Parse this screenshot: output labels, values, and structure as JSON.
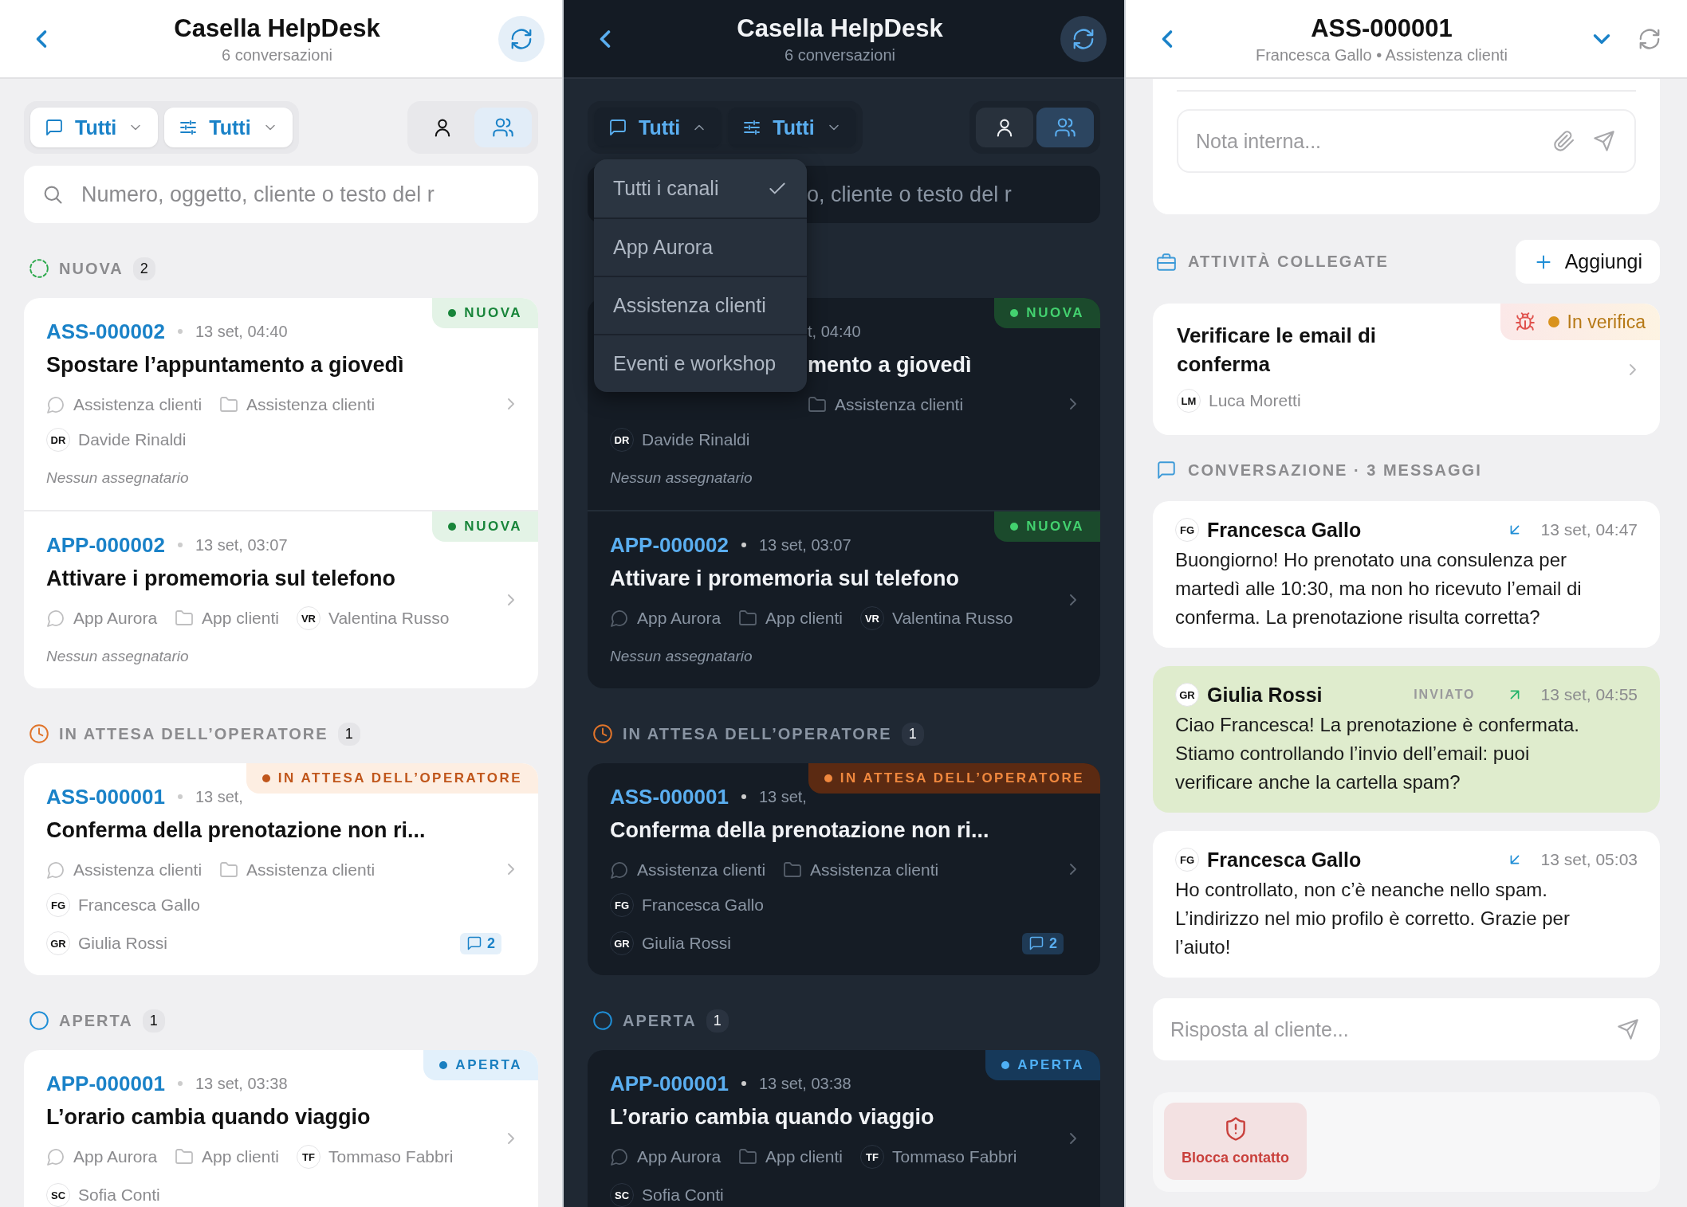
{
  "panels": [
    {
      "kind": "list",
      "dark": false,
      "header": {
        "title": "Casella HelpDesk",
        "subtitle": "6 conversazioni"
      },
      "filters": [
        {
          "kind": "channel",
          "label": "Tutti",
          "expanded": false
        },
        {
          "kind": "status",
          "label": "Tutti",
          "expanded": false
        }
      ],
      "views": [
        {
          "kind": "mine",
          "selected": false
        },
        {
          "kind": "team",
          "selected": true
        }
      ],
      "search": {
        "placeholder": "Numero, oggetto, cliente o testo del r"
      },
      "sections": [
        {
          "kind": "new",
          "label": "NUOVA",
          "count": "2",
          "tickets": [
            {
              "id": "ASS-000002",
              "time": "13 set, 04:40",
              "title": "Spostare l’appuntamento a giovedì",
              "channel": "Assistenza clienti",
              "folder": "Assistenza clienti",
              "customer": {
                "initials": "DR",
                "name": "Davide Rinaldi"
              },
              "unassigned": "Nessun assegnatario",
              "badge": {
                "kind": "new",
                "label": "NUOVA"
              }
            },
            {
              "id": "APP-000002",
              "time": "13 set, 03:07",
              "title": "Attivare i promemoria sul telefono",
              "channel": "App Aurora",
              "folder": "App clienti",
              "customer": {
                "initials": "VR",
                "name": "Valentina Russo"
              },
              "unassigned": "Nessun assegnatario",
              "badge": {
                "kind": "new",
                "label": "NUOVA"
              }
            }
          ]
        },
        {
          "kind": "waiting",
          "label": "IN ATTESA DELL’OPERATORE",
          "count": "1",
          "tickets": [
            {
              "id": "ASS-000001",
              "time": "13 set,",
              "title": "Conferma della prenotazione non ri...",
              "channel": "Assistenza clienti",
              "folder": "Assistenza clienti",
              "customer": {
                "initials": "FG",
                "name": "Francesca Gallo"
              },
              "assignee": {
                "initials": "GR",
                "name": "Giulia Rossi"
              },
              "replies": "2",
              "badge": {
                "kind": "waiting",
                "label": "IN ATTESA DELL’OPERATORE"
              }
            }
          ]
        },
        {
          "kind": "open",
          "label": "APERTA",
          "count": "1",
          "tickets": [
            {
              "id": "APP-000001",
              "time": "13 set, 03:38",
              "title": "L’orario cambia quando viaggio",
              "channel": "App Aurora",
              "folder": "App clienti",
              "customer": {
                "initials": "TF",
                "name": "Tommaso Fabbri"
              },
              "assignee": {
                "initials": "SC",
                "name": "Sofia Conti"
              },
              "badge": {
                "kind": "open",
                "label": "APERTA"
              }
            }
          ]
        }
      ]
    },
    {
      "kind": "list",
      "dark": true,
      "header": {
        "title": "Casella HelpDesk",
        "subtitle": "6 conversazioni"
      },
      "filters": [
        {
          "kind": "channel",
          "label": "Tutti",
          "expanded": true
        },
        {
          "kind": "status",
          "label": "Tutti",
          "expanded": false
        }
      ],
      "views": [
        {
          "kind": "mine",
          "selected": false
        },
        {
          "kind": "team",
          "selected": true
        }
      ],
      "menu": [
        {
          "label": "Tutti i canali",
          "selected": true
        },
        {
          "label": "App Aurora",
          "selected": false
        },
        {
          "label": "Assistenza clienti",
          "selected": false
        },
        {
          "label": "Eventi e workshop",
          "selected": false
        }
      ],
      "search": {
        "placeholder": "o, cliente o testo del r",
        "covered": true
      },
      "sections": [
        {
          "kind": "new",
          "tickets": [
            {
              "covered": true,
              "time": "t, 04:40",
              "title": "mento a giovedì",
              "folder": "Assistenza clienti",
              "customer": {
                "initials": "DR",
                "name": "Davide Rinaldi"
              },
              "unassigned": "Nessun assegnatario",
              "badge": {
                "kind": "new",
                "label": "NUOVA"
              }
            },
            {
              "id": "APP-000002",
              "time": "13 set, 03:07",
              "title": "Attivare i promemoria sul telefono",
              "channel": "App Aurora",
              "folder": "App clienti",
              "customer": {
                "initials": "VR",
                "name": "Valentina Russo"
              },
              "unassigned": "Nessun assegnatario",
              "badge": {
                "kind": "new",
                "label": "NUOVA"
              }
            }
          ]
        },
        {
          "kind": "waiting",
          "label": "IN ATTESA DELL’OPERATORE",
          "count": "1",
          "tickets": [
            {
              "id": "ASS-000001",
              "time": "13 set,",
              "title": "Conferma della prenotazione non ri...",
              "channel": "Assistenza clienti",
              "folder": "Assistenza clienti",
              "customer": {
                "initials": "FG",
                "name": "Francesca Gallo"
              },
              "assignee": {
                "initials": "GR",
                "name": "Giulia Rossi"
              },
              "replies": "2",
              "badge": {
                "kind": "waiting",
                "label": "IN ATTESA DELL’OPERATORE"
              }
            }
          ]
        },
        {
          "kind": "open",
          "label": "APERTA",
          "count": "1",
          "tickets": [
            {
              "id": "APP-000001",
              "time": "13 set, 03:38",
              "title": "L’orario cambia quando viaggio",
              "channel": "App Aurora",
              "folder": "App clienti",
              "customer": {
                "initials": "TF",
                "name": "Tommaso Fabbri"
              },
              "assignee": {
                "initials": "SC",
                "name": "Sofia Conti"
              },
              "badge": {
                "kind": "open",
                "label": "APERTA"
              }
            }
          ]
        }
      ]
    },
    {
      "kind": "detail",
      "dark": false,
      "header": {
        "title": "ASS-000001",
        "subtitle": "Francesca Gallo • Assistenza clienti"
      },
      "note": {
        "placeholder": "Nota interna..."
      },
      "tasks_section": {
        "label": "ATTIVITÀ COLLEGATE",
        "action": "Aggiungi"
      },
      "tasks": [
        {
          "kind": "bug",
          "title": "Verificare le email di conferma",
          "status": {
            "kind": "review",
            "label": "In verifica"
          },
          "assignee": {
            "initials": "LM",
            "name": "Luca Moretti"
          }
        }
      ],
      "conversation": {
        "label": "CONVERSAZIONE · 3 MESSAGGI"
      },
      "messages": [
        {
          "kind": "incoming",
          "author": {
            "initials": "FG",
            "name": "Francesca Gallo"
          },
          "time": "13 set, 04:47",
          "text": "Buongiorno! Ho prenotato una consulenza per martedì alle 10:30, ma non ho ricevuto l’email di conferma. La prenotazione risulta corretta?"
        },
        {
          "kind": "outgoing",
          "author": {
            "initials": "GR",
            "name": "Giulia Rossi"
          },
          "status": "INVIATO",
          "time": "13 set, 04:55",
          "text": "Ciao Francesca! La prenotazione è confermata. Stiamo controllando l’invio dell’email: puoi verificare anche la cartella spam?"
        },
        {
          "kind": "incoming",
          "author": {
            "initials": "FG",
            "name": "Francesca Gallo"
          },
          "time": "13 set, 05:03",
          "text": "Ho controllato, non c’è neanche nello spam. L’indirizzo nel mio profilo è corretto. Grazie per l’aiuto!"
        }
      ],
      "reply": {
        "placeholder": "Risposta al cliente..."
      },
      "actions": [
        {
          "kind": "block",
          "label": "Blocca contatto"
        }
      ]
    }
  ]
}
